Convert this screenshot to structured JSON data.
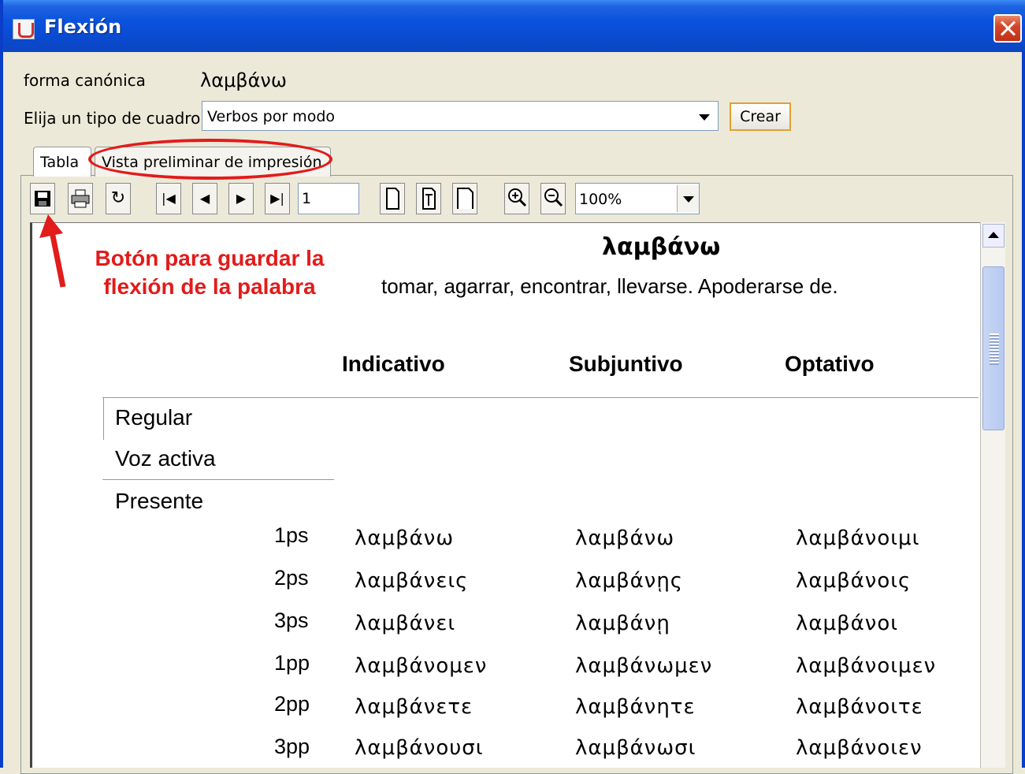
{
  "window": {
    "title": "Flexión"
  },
  "form": {
    "canonical_label": "forma canónica",
    "canonical_value": "λαμβάνω",
    "table_type_label": "Elija un tipo de cuadro",
    "table_type_value": "Verbos por modo",
    "create_button": "Crear"
  },
  "tabs": [
    {
      "label": "Tabla"
    },
    {
      "label": "Vista preliminar de impresión"
    }
  ],
  "toolbar": {
    "page_value": "1",
    "zoom_value": "100%",
    "icons": [
      "save-icon",
      "print-icon",
      "reload-icon",
      "first-page-icon",
      "prev-page-icon",
      "next-page-icon",
      "last-page-icon",
      "page-icon",
      "page-fit-width-icon",
      "page-fit-height-icon",
      "zoom-in-icon",
      "zoom-out-icon"
    ]
  },
  "annotation": {
    "line1": "Botón para guardar la",
    "line2": "flexión de la palabra",
    "color": "#e21b1b"
  },
  "document": {
    "title": "λαμβάνω",
    "gloss": "tomar, agarrar, encontrar, llevarse. Apoderarse de.",
    "columns": [
      "Indicativo",
      "Subjuntivo",
      "Optativo"
    ],
    "sections": [
      "Regular",
      "Voz activa",
      "Presente"
    ],
    "rows": [
      {
        "person": "1ps",
        "indicativo": "λαμβάνω",
        "subjuntivo": "λαμβάνω",
        "optativo": "λαμβάνοιμι"
      },
      {
        "person": "2ps",
        "indicativo": "λαμβάνεις",
        "subjuntivo": "λαμβάνῃς",
        "optativo": "λαμβάνοις"
      },
      {
        "person": "3ps",
        "indicativo": "λαμβάνει",
        "subjuntivo": "λαμβάνῃ",
        "optativo": "λαμβάνοι"
      },
      {
        "person": "1pp",
        "indicativo": "λαμβάνομεν",
        "subjuntivo": "λαμβάνωμεν",
        "optativo": "λαμβάνοιμεν"
      },
      {
        "person": "2pp",
        "indicativo": "λαμβάνετε",
        "subjuntivo": "λαμβάνητε",
        "optativo": "λαμβάνοιτε"
      },
      {
        "person": "3pp",
        "indicativo": "λαμβάνουσι",
        "subjuntivo": "λαμβάνωσι",
        "optativo": "λαμβάνοιεν"
      }
    ]
  }
}
